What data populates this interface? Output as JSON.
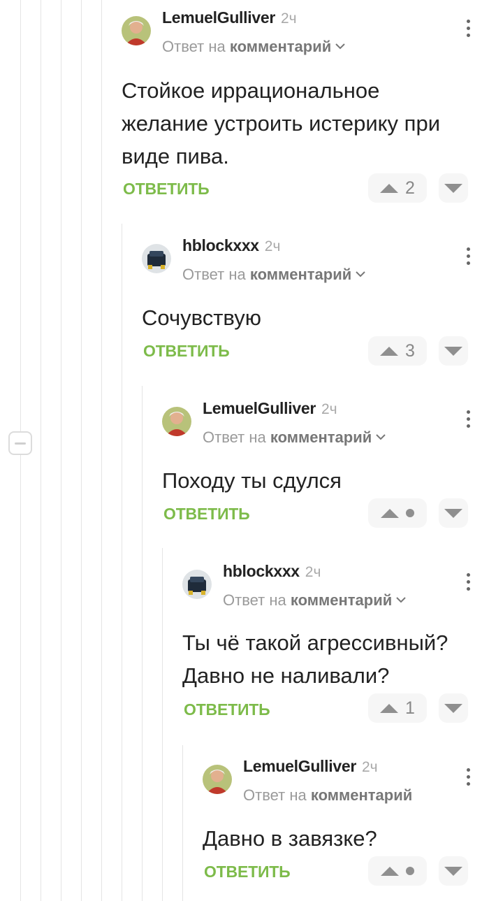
{
  "comments": [
    {
      "username": "LemuelGulliver",
      "time": "2ч",
      "reply_prefix": "Ответ на",
      "reply_link": "комментарий",
      "text_lines": [
        "Стойкое иррациональное",
        "желание устроить истерику при",
        "виде пива."
      ],
      "reply_label": "ОТВЕТИТЬ",
      "score": "2"
    },
    {
      "username": "hblockxxx",
      "time": "2ч",
      "reply_prefix": "Ответ на",
      "reply_link": "комментарий",
      "text_lines": [
        "Сочувствую"
      ],
      "reply_label": "ОТВЕТИТЬ",
      "score": "3"
    },
    {
      "username": "LemuelGulliver",
      "time": "2ч",
      "reply_prefix": "Ответ на",
      "reply_link": "комментарий",
      "text_lines": [
        "Походу ты сдулся"
      ],
      "reply_label": "ОТВЕТИТЬ",
      "score": ""
    },
    {
      "username": "hblockxxx",
      "time": "2ч",
      "reply_prefix": "Ответ на",
      "reply_link": "комментарий",
      "text_lines": [
        "Ты чё такой агрессивный?",
        "Давно не наливали?"
      ],
      "reply_label": "ОТВЕТИТЬ",
      "score": "1"
    },
    {
      "username": "LemuelGulliver",
      "time": "2ч",
      "reply_prefix": "Ответ на",
      "reply_link": "комментарий",
      "text_lines": [
        "Давно в завязке?"
      ],
      "reply_label": "ОТВЕТИТЬ",
      "score": ""
    }
  ],
  "colors": {
    "reply_green": "#7dbb4a",
    "thread_line": "#e4e4e4",
    "vote_bg": "#f6f6f6"
  },
  "icons": [
    "collapse-thread-icon",
    "more-vertical-icon",
    "chevron-down-icon",
    "arrow-up-icon",
    "arrow-down-icon",
    "avatar-icon"
  ]
}
